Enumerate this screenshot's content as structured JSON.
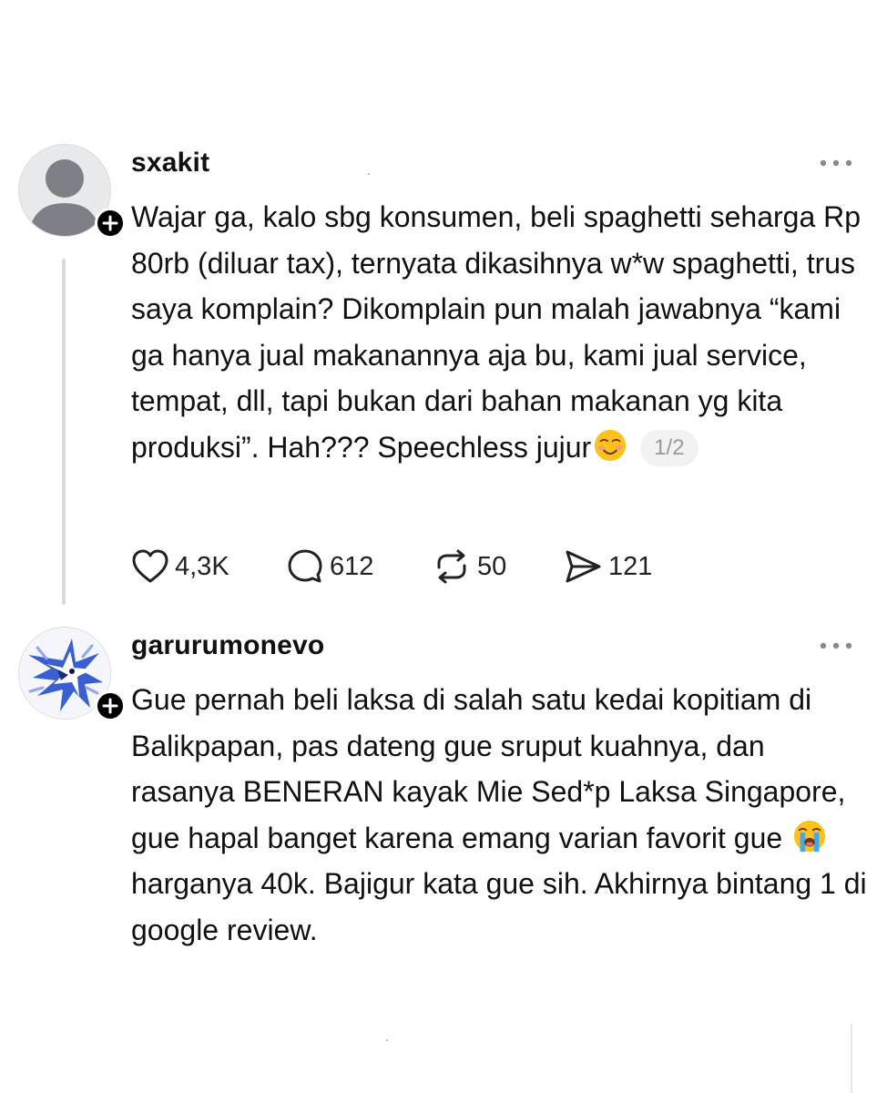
{
  "posts": [
    {
      "username": "sxakit",
      "text": "Wajar ga, kalo sbg konsumen, beli spaghetti seharga Rp 80rb (diluar tax), ternyata dikasihnya w*w spaghetti, trus saya komplain? Dikomplain pun malah jawabnya “kami ga hanya jual makanannya aja bu, kami jual service, tempat, dll, tapi bukan dari bahan makanan yg kita produksi”. Hah??? Speechless jujur",
      "emoji": "smiling-face-emoji",
      "page_indicator": "1/2",
      "likes": "4,3K",
      "replies": "612",
      "reposts": "50",
      "shares": "121"
    },
    {
      "username": "garurumonevo",
      "text_before_emoji": "Gue pernah beli laksa di salah satu kedai kopitiam di Balikpapan, pas dateng gue sruput kuahnya, dan rasanya BENERAN kayak Mie Sed*p Laksa Singapore, gue hapal banget karena emang varian favorit gue",
      "emoji": "loudly-crying-face-emoji",
      "text_after_emoji": "harganya 40k. Bajigur kata gue sih. Akhirnya bintang 1 di google review."
    }
  ],
  "icons": {
    "like": "heart-icon",
    "reply": "comment-icon",
    "repost": "repost-icon",
    "share": "share-icon",
    "more": "more-options-icon",
    "follow": "plus-icon"
  }
}
